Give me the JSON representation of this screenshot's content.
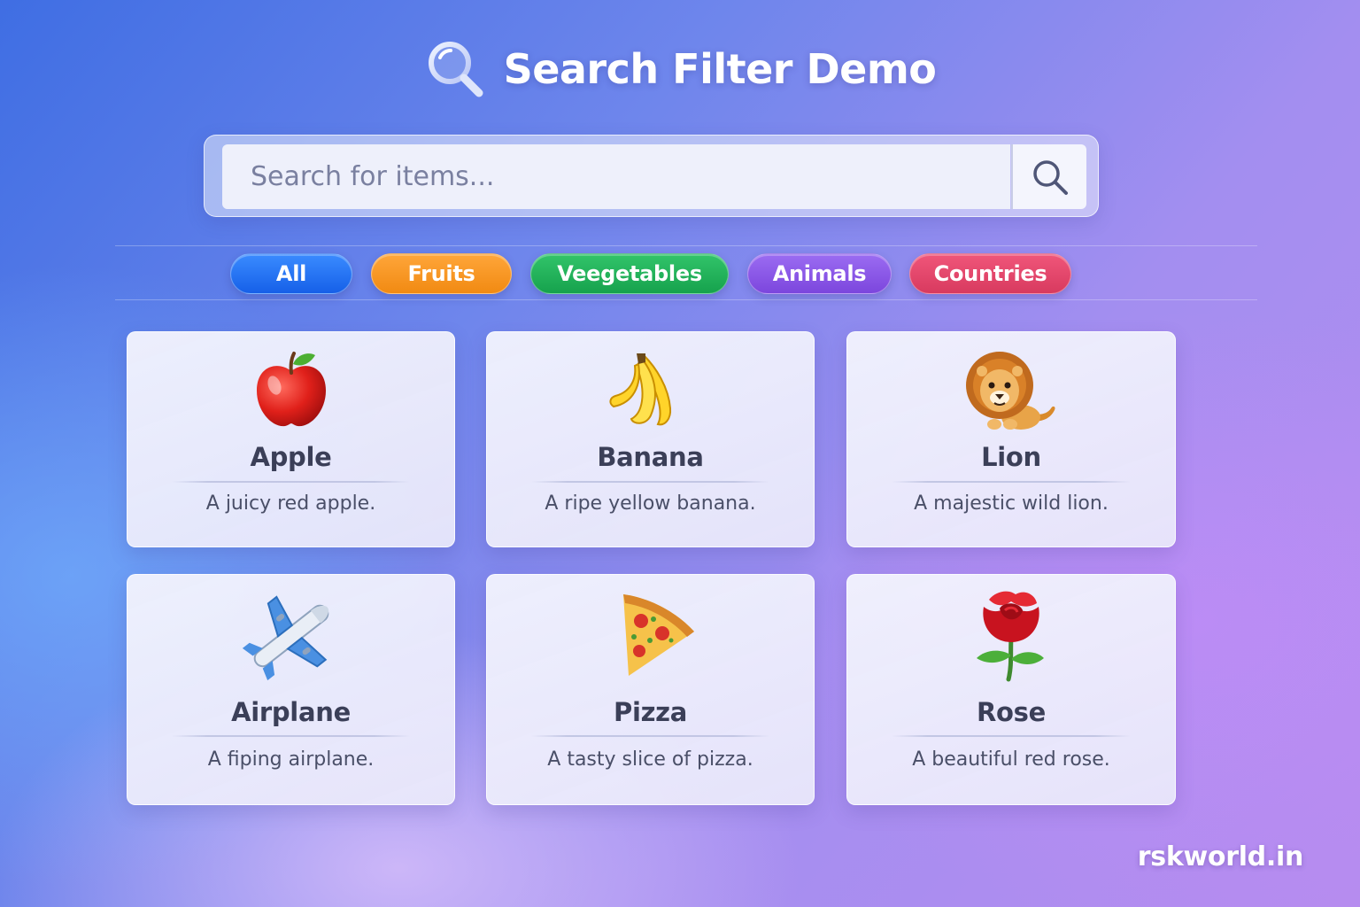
{
  "header": {
    "title": "Search Filter Demo",
    "icon": "magnifier-icon"
  },
  "search": {
    "placeholder": "Search for items...",
    "value": "",
    "button_icon": "search-icon"
  },
  "filters": [
    {
      "label": "All",
      "color": "#1e6cf0"
    },
    {
      "label": "Fruits",
      "color": "#f7941d"
    },
    {
      "label": "Veegetables",
      "color": "#1fae55"
    },
    {
      "label": "Animals",
      "color": "#8656e6"
    },
    {
      "label": "Countries",
      "color": "#e2456a"
    }
  ],
  "items": [
    {
      "icon": "apple-icon",
      "name": "Apple",
      "description": "A juicy red apple."
    },
    {
      "icon": "banana-icon",
      "name": "Banana",
      "description": "A ripe yellow banana."
    },
    {
      "icon": "lion-icon",
      "name": "Lion",
      "description": "A majestic wild lion."
    },
    {
      "icon": "airplane-icon",
      "name": "Airplane",
      "description": "A fiping airplane."
    },
    {
      "icon": "pizza-icon",
      "name": "Pizza",
      "description": "A tasty slice of pizza."
    },
    {
      "icon": "rose-icon",
      "name": "Rose",
      "description": "A beautiful red rose."
    }
  ],
  "footer": {
    "brand": "rskworld.in"
  }
}
